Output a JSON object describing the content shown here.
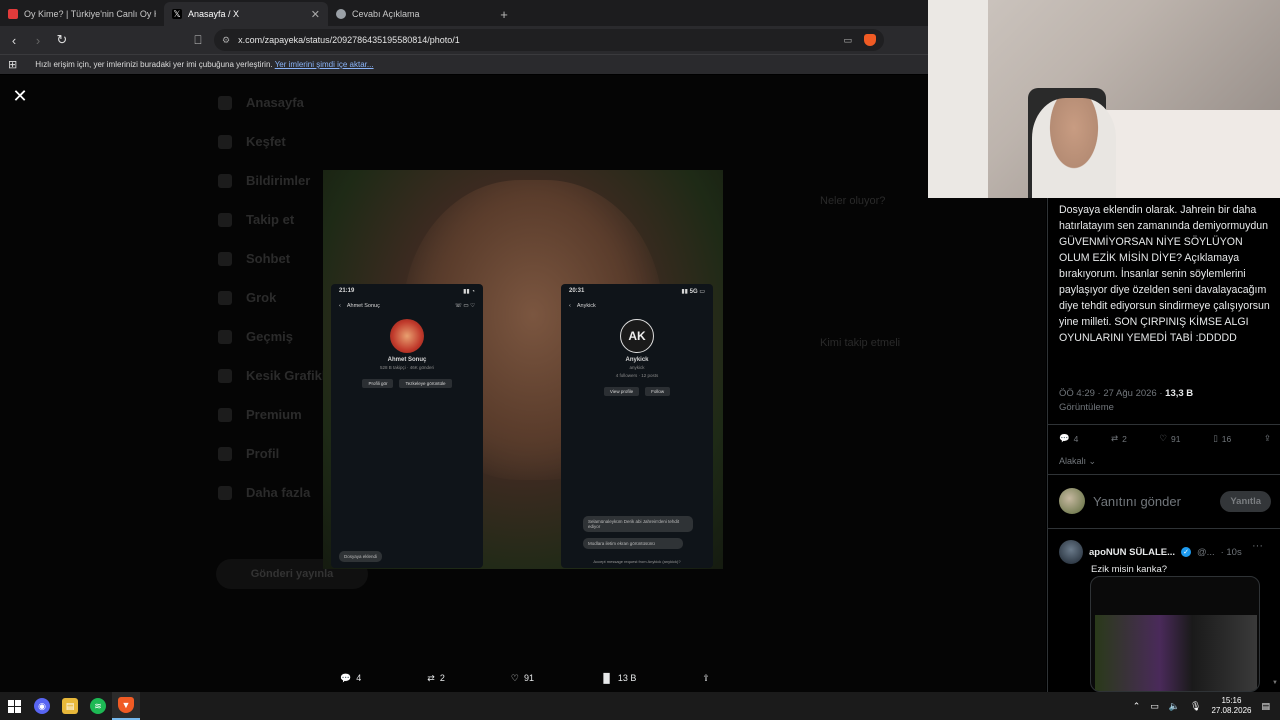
{
  "browser": {
    "tabs": [
      {
        "title": "Oy Kime? | Türkiye'nin Canlı Oy Harit",
        "favicon_color": "#e23b3b",
        "active": false
      },
      {
        "title": "Anasayfa / X",
        "favicon_color": "#000000",
        "active": true
      },
      {
        "title": "Cevabı Açıklama",
        "favicon_color": "#9aa0a6",
        "active": false
      }
    ],
    "new_tab_label": "+",
    "url": "x.com/zapayeka/status/2092786435195580814/photo/1",
    "bookmarks_bar_text": "Hızlı erişim için, yer imlerinizi buradaki yer imi çubuğuna yerleştirin.",
    "bookmarks_import_link": "Yer imlerini şimdi içe aktar...",
    "brand_color": "#f05b24"
  },
  "background_nav": {
    "items": [
      "Anasayfa",
      "Keşfet",
      "Bildirimler",
      "Takip et",
      "Sohbet",
      "Grok",
      "Geçmiş",
      "Kesik Grafikleri",
      "Premium",
      "Profil",
      "Daha fazla"
    ],
    "post_button": "Gönderi yayınla",
    "right_items": [
      "Neler oluyor?",
      "Kimi takip etmeli"
    ]
  },
  "photo": {
    "left_phone": {
      "time": "21:19",
      "name": "Ahmet Sonuç",
      "sub": "528 B takipçi · 46K gönderi",
      "btn1": "Profili gör",
      "btn2": "Tezkeleye görüntüle",
      "bubble": "Dosyaya eklendi"
    },
    "right_phone": {
      "time": "20:31",
      "header": "Anykick",
      "logo_text": "AK",
      "name": "Anykick",
      "sub1": "anykick",
      "sub2": "4 followers · 12 posts",
      "btn1": "View profile",
      "btn2": "Follow",
      "bubble1": "Selamünaleyküm Derik abi Jahrein'deni tehdit ediyor",
      "bubble2": "Modlara iletim ekran görüntüsünü",
      "footer": "Accept message request from Anykick (anykick)?"
    }
  },
  "viewer_actions": {
    "replies": "4",
    "reposts": "2",
    "likes": "91",
    "views": "13 B"
  },
  "tweet": {
    "text": "Dosyaya eklendin olarak. Jahrein bir daha hatırlatayım sen zamanında demiyormuydun GÜVENMİYORSAN NİYE SÖYLÜYON OLUM EZİK MİSİN DİYE? Açıklamaya bırakıyorum. İnsanlar senin söylemlerini paylaşıyor diye özelden seni davalayacağım diye tehdit ediyorsun sindirmeye çalışıyorsun yine milleti. SON ÇIRPINIŞ KİMSE ALGI OYUNLARINI YEMEDİ TABİ :DDDDD",
    "time": "ÖÖ 4:29 · 27 Ağu 2026 · ",
    "views": "13,3 B",
    "views_label": "Görüntüleme",
    "replies": "4",
    "reposts": "2",
    "likes": "91",
    "bookmarks": "16",
    "sort_label": "Alakalı",
    "reply_placeholder": "Yanıtını gönder",
    "reply_button": "Yanıtla",
    "accent": "#1d9bf0"
  },
  "reply": {
    "name": "apoNUN SÜLALE...",
    "handle": "@...",
    "time": "· 10s",
    "text": "Ezik misin kanka?"
  },
  "taskbar": {
    "time": "15:16",
    "date": "27.08.2026"
  }
}
